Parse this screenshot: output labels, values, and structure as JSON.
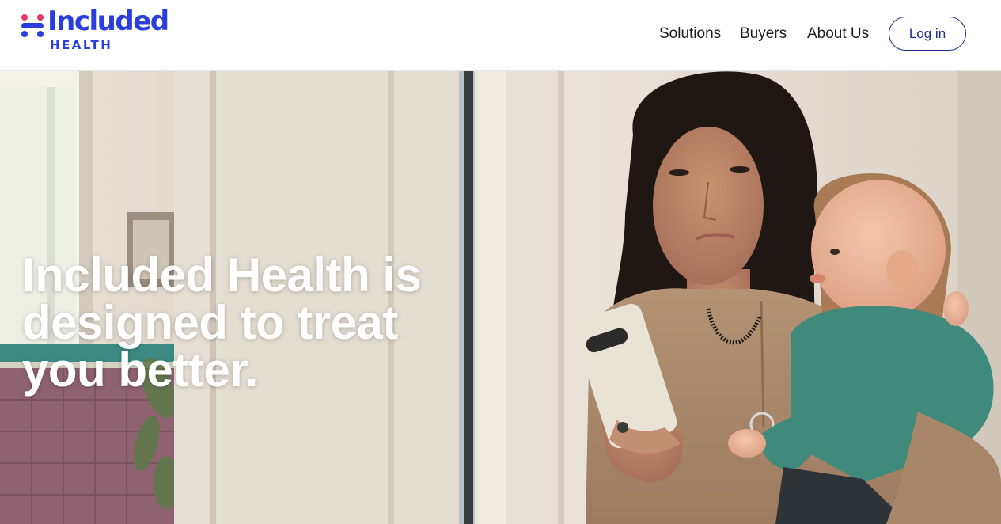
{
  "brand": {
    "name": "Included",
    "subtitle": "HEALTH",
    "color": "#2a3ee0",
    "mark_colors": [
      "#e8336d",
      "#2a3ee0"
    ],
    "mark_icon": "included-health-logo-mark"
  },
  "nav": {
    "items": [
      {
        "label": "Solutions"
      },
      {
        "label": "Buyers"
      },
      {
        "label": "About Us"
      }
    ],
    "login_label": "Log in",
    "login_color": "#1f2a8a"
  },
  "hero": {
    "heading": "Included Health is designed to treat you better.",
    "photo_icon": "hero-photo-mother-with-baby-and-phone"
  }
}
